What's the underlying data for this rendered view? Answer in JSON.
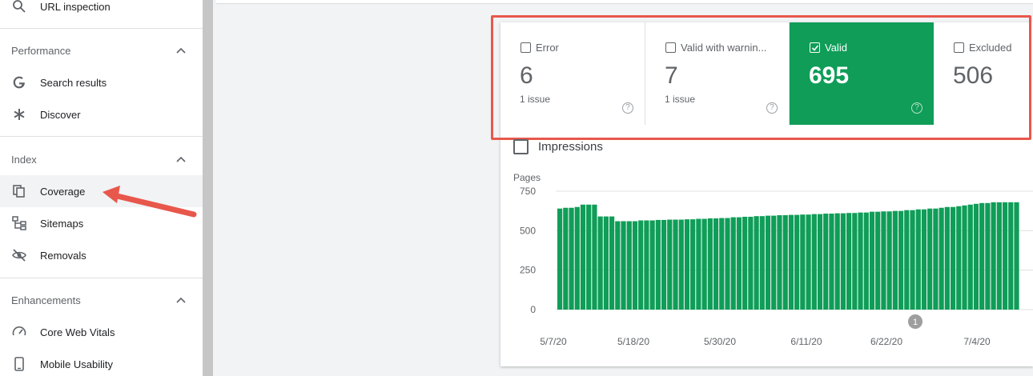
{
  "sidebar": {
    "url_inspection": "URL inspection",
    "performance": {
      "title": "Performance",
      "items": [
        "Search results",
        "Discover"
      ]
    },
    "index": {
      "title": "Index",
      "items": [
        "Coverage",
        "Sitemaps",
        "Removals"
      ],
      "active": "Coverage"
    },
    "enhancements": {
      "title": "Enhancements",
      "items": [
        "Core Web Vitals",
        "Mobile Usability"
      ]
    }
  },
  "tiles": [
    {
      "label": "Error",
      "value": "6",
      "sub": "1 issue",
      "selected": false
    },
    {
      "label": "Valid with warnin...",
      "value": "7",
      "sub": "1 issue",
      "selected": false
    },
    {
      "label": "Valid",
      "value": "695",
      "sub": "",
      "selected": true
    },
    {
      "label": "Excluded",
      "value": "506",
      "sub": "",
      "selected": false
    }
  ],
  "impressions_label": "Impressions",
  "colors": {
    "valid": "#0f9d58",
    "highlight": "#e8574b",
    "arrow": "#e8574b"
  },
  "chart_data": {
    "type": "bar",
    "ylabel": "Pages",
    "ylim": [
      0,
      750
    ],
    "yticks": [
      0,
      250,
      500,
      750
    ],
    "xticks": [
      "5/7/20",
      "5/18/20",
      "5/30/20",
      "6/11/20",
      "6/22/20",
      "7/4/20"
    ],
    "annotation": "1",
    "series": [
      {
        "values": [
          640,
          645,
          645,
          650,
          665,
          665,
          665,
          590,
          590,
          590,
          560,
          560,
          560,
          560,
          565,
          565,
          565,
          568,
          568,
          570,
          570,
          570,
          572,
          572,
          575,
          575,
          578,
          578,
          580,
          580,
          585,
          585,
          588,
          588,
          592,
          592,
          595,
          595,
          598,
          598,
          600,
          600,
          602,
          602,
          605,
          605,
          608,
          608,
          610,
          610,
          612,
          612,
          615,
          615,
          620,
          620,
          622,
          622,
          625,
          625,
          630,
          630,
          635,
          635,
          640,
          640,
          645,
          650,
          650,
          655,
          660,
          665,
          670,
          675,
          675,
          680,
          680,
          680,
          680,
          680
        ]
      }
    ]
  }
}
